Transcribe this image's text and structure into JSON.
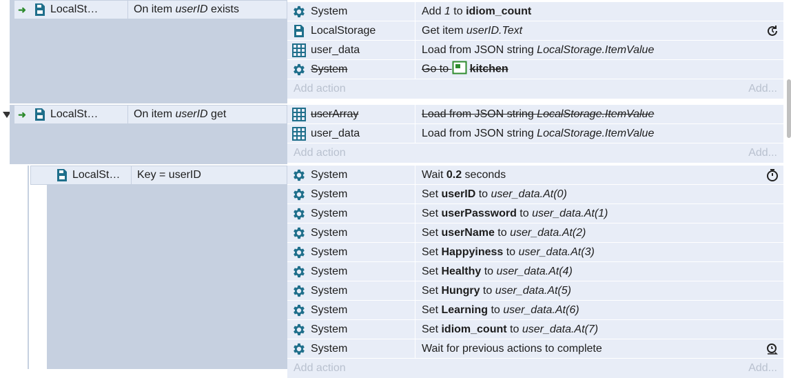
{
  "events": [
    {
      "object": "LocalSt…",
      "condition": {
        "prefix": "On item ",
        "italic": "userID",
        "suffix": " exists"
      },
      "actions": [
        {
          "object": "System",
          "icon": "gear-icon",
          "parts": [
            {
              "t": "Add "
            },
            {
              "t": "1",
              "s": "i"
            },
            {
              "t": " to "
            },
            {
              "t": "idiom_count",
              "s": "b"
            }
          ]
        },
        {
          "object": "LocalStorage",
          "icon": "localstorage-icon",
          "parts": [
            {
              "t": "Get item "
            },
            {
              "t": "userID.Text",
              "s": "i"
            }
          ],
          "right_icon": "async-icon"
        },
        {
          "object": "user_data",
          "icon": "array-icon",
          "parts": [
            {
              "t": "Load from JSON string "
            },
            {
              "t": "LocalStorage.ItemValue",
              "s": "i"
            }
          ]
        },
        {
          "object": "System",
          "icon": "gear-icon",
          "disabled": true,
          "parts": [
            {
              "t": "Go to "
            },
            {
              "t": "kitchen",
              "s": "b"
            }
          ],
          "layout_icon": true
        }
      ],
      "add_action": "Add action",
      "add_more": "Add..."
    },
    {
      "object": "LocalSt…",
      "condition": {
        "prefix": "On item ",
        "italic": "userID",
        "suffix": " get"
      },
      "actions": [
        {
          "object": "userArray",
          "icon": "array-icon",
          "disabled": true,
          "parts": [
            {
              "t": "Load from JSON string "
            },
            {
              "t": "LocalStorage.ItemValue",
              "s": "i"
            }
          ]
        },
        {
          "object": "user_data",
          "icon": "array-icon",
          "parts": [
            {
              "t": "Load from JSON string "
            },
            {
              "t": "LocalStorage.ItemValue",
              "s": "i"
            }
          ]
        }
      ],
      "add_action": "Add action",
      "add_more": "Add..."
    },
    {
      "object": "LocalSt…",
      "condition": {
        "prefix": "Key = userID",
        "italic": "",
        "suffix": ""
      },
      "actions": [
        {
          "object": "System",
          "icon": "gear-icon",
          "parts": [
            {
              "t": "Wait "
            },
            {
              "t": "0.2",
              "s": "b"
            },
            {
              "t": " seconds"
            }
          ],
          "right_icon": "stopwatch-icon"
        },
        {
          "object": "System",
          "icon": "gear-icon",
          "parts": [
            {
              "t": "Set "
            },
            {
              "t": "userID",
              "s": "b"
            },
            {
              "t": " to "
            },
            {
              "t": "user_data.At(0)",
              "s": "i"
            }
          ]
        },
        {
          "object": "System",
          "icon": "gear-icon",
          "parts": [
            {
              "t": "Set "
            },
            {
              "t": "userPassword",
              "s": "b"
            },
            {
              "t": " to "
            },
            {
              "t": "user_data.At(1)",
              "s": "i"
            }
          ]
        },
        {
          "object": "System",
          "icon": "gear-icon",
          "parts": [
            {
              "t": "Set "
            },
            {
              "t": "userName",
              "s": "b"
            },
            {
              "t": " to "
            },
            {
              "t": "user_data.At(2)",
              "s": "i"
            }
          ]
        },
        {
          "object": "System",
          "icon": "gear-icon",
          "parts": [
            {
              "t": "Set "
            },
            {
              "t": "Happyiness",
              "s": "b"
            },
            {
              "t": " to "
            },
            {
              "t": "user_data.At(3)",
              "s": "i"
            }
          ]
        },
        {
          "object": "System",
          "icon": "gear-icon",
          "parts": [
            {
              "t": "Set "
            },
            {
              "t": "Healthy",
              "s": "b"
            },
            {
              "t": " to "
            },
            {
              "t": "user_data.At(4)",
              "s": "i"
            }
          ]
        },
        {
          "object": "System",
          "icon": "gear-icon",
          "parts": [
            {
              "t": "Set "
            },
            {
              "t": "Hungry",
              "s": "b"
            },
            {
              "t": " to "
            },
            {
              "t": "user_data.At(5)",
              "s": "i"
            }
          ]
        },
        {
          "object": "System",
          "icon": "gear-icon",
          "parts": [
            {
              "t": "Set "
            },
            {
              "t": "Learning",
              "s": "b"
            },
            {
              "t": " to "
            },
            {
              "t": "user_data.At(6)",
              "s": "i"
            }
          ]
        },
        {
          "object": "System",
          "icon": "gear-icon",
          "parts": [
            {
              "t": "Set "
            },
            {
              "t": "idiom_count",
              "s": "b"
            },
            {
              "t": " to "
            },
            {
              "t": "user_data.At(7)",
              "s": "i"
            }
          ]
        },
        {
          "object": "System",
          "icon": "gear-icon",
          "parts": [
            {
              "t": "Wait for previous actions to complete"
            }
          ],
          "right_icon": "wait-complete-icon"
        }
      ],
      "add_action": "Add action",
      "add_more": "Add..."
    }
  ],
  "colors": {
    "accent": "#1f6f8b",
    "block": "#c6d0e0",
    "row": "#e8edf7",
    "trigger": "#2e8b2e"
  }
}
